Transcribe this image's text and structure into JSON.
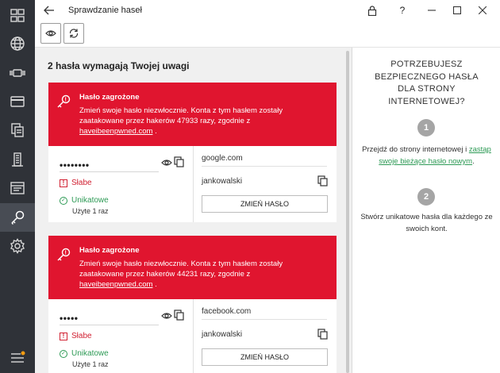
{
  "window": {
    "title": "Sprawdzanie haseł",
    "controls": [
      "lock-icon",
      "help-icon",
      "minimize-icon",
      "maximize-icon",
      "close-icon"
    ],
    "help_label": "?"
  },
  "sidebar": {
    "items": [
      "dashboard-icon",
      "globe-icon",
      "webcam-icon",
      "card-icon",
      "documents-icon",
      "building-icon",
      "notes-icon",
      "key-icon",
      "settings-icon",
      "menu-icon"
    ],
    "active": "key-icon",
    "badge_color": "#f39c12"
  },
  "toolbar": {
    "buttons": [
      "eye-icon",
      "refresh-icon"
    ]
  },
  "main": {
    "heading": "2 hasła wymagają Twojej uwagi",
    "cards": [
      {
        "alert_title": "Hasło zagrożone",
        "alert_text": "Zmień swoje hasło niezwłocznie. Konta z tym hasłem zostały zaatakowane przez hakerów 47933 razy, zgodnie z ",
        "alert_link": "haveibeenpwned.com",
        "alert_suffix": " .",
        "password": "••••••••",
        "strength": "Słabe",
        "uniqueness": "Unikatowe",
        "used": "Użyte 1 raz",
        "site": "google.com",
        "username": "jankowalski",
        "change_button": "ZMIEŃ HASŁO"
      },
      {
        "alert_title": "Hasło zagrożone",
        "alert_text": "Zmień swoje hasło niezwłocznie. Konta z tym hasłem zostały zaatakowane przez hakerów 44231 razy, zgodnie z ",
        "alert_link": "haveibeenpwned.com",
        "alert_suffix": " .",
        "password": "•••••",
        "strength": "Słabe",
        "uniqueness": "Unikatowe",
        "used": "Użyte 1 raz",
        "site": "facebook.com",
        "username": "jankowalski",
        "change_button": "ZMIEŃ HASŁO"
      }
    ]
  },
  "right_panel": {
    "title_lines": [
      "POTRZEBUJESZ",
      "BEZPIECZNEGO HASŁA",
      "DLA STRONY",
      "INTERNETOWEJ?"
    ],
    "step1_number": "1",
    "step1_text": "Przejdź do strony internetowej i ",
    "step1_link": "zastąp swoje bieżące hasło nowym",
    "step1_suffix": ".",
    "step2_number": "2",
    "step2_text": "Stwórz unikatowe hasła dla każdego ze swoich kont."
  },
  "colors": {
    "alert_red": "#e0152f",
    "sidebar_bg": "#2f3238",
    "weak_red": "#d12233",
    "unique_green": "#2d9a55"
  }
}
